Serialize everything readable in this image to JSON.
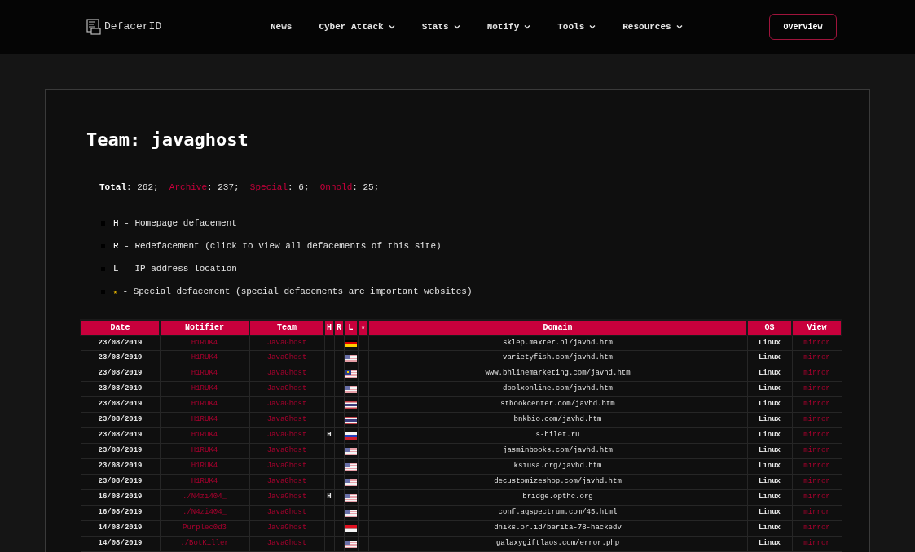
{
  "nav": {
    "logo": "DefacerID",
    "items": [
      {
        "label": "News",
        "dropdown": false
      },
      {
        "label": "Cyber Attack",
        "dropdown": true
      },
      {
        "label": "Stats",
        "dropdown": true
      },
      {
        "label": "Notify",
        "dropdown": true
      },
      {
        "label": "Tools",
        "dropdown": true
      },
      {
        "label": "Resources",
        "dropdown": true
      }
    ],
    "button": "Overview"
  },
  "title": "Team: javaghost",
  "stats": [
    {
      "label": "Total",
      "value": ": 262;",
      "highlight": false
    },
    {
      "label": "Archive",
      "value": ": 237;",
      "highlight": true
    },
    {
      "label": "Special",
      "value": ": 6;",
      "highlight": true
    },
    {
      "label": "Onhold",
      "value": ": 25;",
      "highlight": true
    }
  ],
  "legend": [
    {
      "key": "H",
      "text": "- Homepage defacement",
      "kind": "letter"
    },
    {
      "key": "R",
      "text": "- Redefacement (click to view all defacements of this site)",
      "kind": "letter"
    },
    {
      "key": "L",
      "text": "- IP address location",
      "kind": "letter"
    },
    {
      "key": "★",
      "text": "- Special defacement (special defacements are important websites)",
      "kind": "star"
    }
  ],
  "table": {
    "columns": [
      "Date",
      "Notifier",
      "Team",
      "H",
      "R",
      "L",
      "★",
      "Domain",
      "OS",
      "View"
    ],
    "rows": [
      {
        "date": "23/08/2019",
        "notifier": "H1RUK4",
        "team": "JavaGhost",
        "kind": "de",
        "domain": "sklep.maxter.pl/javhd.htm",
        "os": "Linux",
        "view": "mirror"
      },
      {
        "date": "23/08/2019",
        "notifier": "H1RUK4",
        "team": "JavaGhost",
        "kind": "us",
        "domain": "varietyfish.com/javhd.htm",
        "os": "Linux",
        "view": "mirror"
      },
      {
        "date": "23/08/2019",
        "notifier": "H1RUK4",
        "team": "JavaGhost",
        "kind": "my",
        "domain": "www.bhlinemarketing.com/javhd.htm",
        "os": "Linux",
        "view": "mirror"
      },
      {
        "date": "23/08/2019",
        "notifier": "H1RUK4",
        "team": "JavaGhost",
        "kind": "us",
        "domain": "doolxonline.com/javhd.htm",
        "os": "Linux",
        "view": "mirror"
      },
      {
        "date": "23/08/2019",
        "notifier": "H1RUK4",
        "team": "JavaGhost",
        "kind": "th",
        "domain": "stbookcenter.com/javhd.htm",
        "os": "Linux",
        "view": "mirror"
      },
      {
        "date": "23/08/2019",
        "notifier": "H1RUK4",
        "team": "JavaGhost",
        "kind": "th",
        "domain": "bnkbio.com/javhd.htm",
        "os": "Linux",
        "view": "mirror"
      },
      {
        "date": "23/08/2019",
        "notifier": "H1RUK4",
        "team": "JavaGhost",
        "h": "H",
        "kind": "ru",
        "domain": "s-bilet.ru",
        "os": "Linux",
        "view": "mirror"
      },
      {
        "date": "23/08/2019",
        "notifier": "H1RUK4",
        "team": "JavaGhost",
        "kind": "us",
        "domain": "jasminbooks.com/javhd.htm",
        "os": "Linux",
        "view": "mirror"
      },
      {
        "date": "23/08/2019",
        "notifier": "H1RUK4",
        "team": "JavaGhost",
        "kind": "us",
        "domain": "ksiusa.org/javhd.htm",
        "os": "Linux",
        "view": "mirror"
      },
      {
        "date": "23/08/2019",
        "notifier": "H1RUK4",
        "team": "JavaGhost",
        "kind": "us",
        "domain": "decustomizeshop.com/javhd.htm",
        "os": "Linux",
        "view": "mirror"
      },
      {
        "date": "16/08/2019",
        "notifier": "./N4zi404_",
        "team": "JavaGhost",
        "h": "H",
        "kind": "us",
        "domain": "bridge.opthc.org",
        "os": "Linux",
        "view": "mirror"
      },
      {
        "date": "16/08/2019",
        "notifier": "./N4zi404_",
        "team": "JavaGhost",
        "kind": "us",
        "domain": "conf.agspectrum.com/45.html",
        "os": "Linux",
        "view": "mirror"
      },
      {
        "date": "14/08/2019",
        "notifier": "Purplec0d3",
        "team": "JavaGhost",
        "kind": "id",
        "domain": "dniks.or.id/berita-78-hackedv",
        "os": "Linux",
        "view": "mirror"
      },
      {
        "date": "14/08/2019",
        "notifier": "./BotKiller",
        "team": "JavaGhost",
        "kind": "us",
        "domain": "galaxygiftlaos.com/error.php",
        "os": "Linux",
        "view": "mirror"
      }
    ]
  }
}
